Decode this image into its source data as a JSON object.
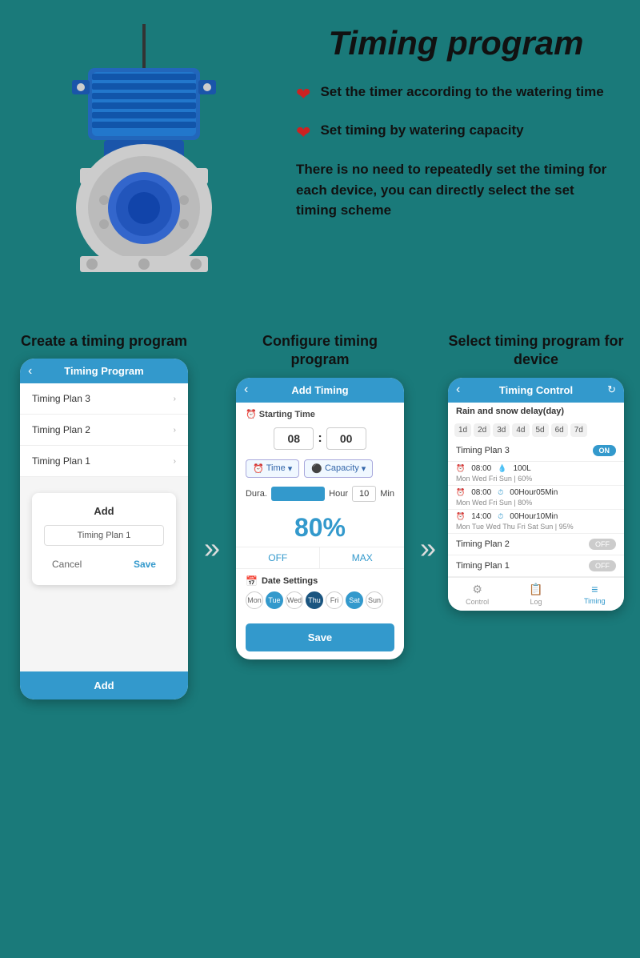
{
  "page": {
    "title": "Timing program",
    "background_color": "#1a7a7a"
  },
  "features": {
    "item1": "Set the timer according to the watering time",
    "item2": "Set timing by watering capacity",
    "description": "There is no need to repeatedly set the timing for each device, you can directly select the set timing scheme"
  },
  "steps": {
    "step1": {
      "title": "Create a timing program",
      "screen": {
        "header": "Timing Program",
        "plans": [
          "Timing Plan 3",
          "Timing Plan 2",
          "Timing Plan 1"
        ],
        "dialog_title": "Add",
        "dialog_input": "Timing Plan 1",
        "cancel_label": "Cancel",
        "save_label": "Save",
        "footer_add": "Add"
      }
    },
    "step2": {
      "title": "Configure timing program",
      "screen": {
        "header": "Add Timing",
        "starting_time_label": "Starting Time",
        "hour": "08",
        "minute": "00",
        "time_label": "Time",
        "capacity_label": "Capacity",
        "dura_label": "Dura.",
        "hour_label": "Hour",
        "min_value": "10",
        "min_label": "Min",
        "percent": "80%",
        "off_label": "OFF",
        "max_label": "MAX",
        "date_settings_label": "Date Settings",
        "days": [
          "Mon",
          "Tue",
          "Wed",
          "Thu",
          "Fri",
          "Sat",
          "Sun"
        ],
        "active_days": [
          "Tue",
          "Thu",
          "Sat"
        ],
        "save_btn": "Save"
      }
    },
    "step3": {
      "title": "Select timing program for device",
      "screen": {
        "header": "Timing Control",
        "rain_delay": "Rain and snow delay(day)",
        "day_buttons": [
          "1d",
          "2d",
          "3d",
          "4d",
          "5d",
          "6d",
          "7d"
        ],
        "plans": [
          {
            "name": "Timing Plan 3",
            "toggle": "ON",
            "entries": [
              {
                "time": "08:00",
                "capacity": "100L",
                "days": "Mon Wed Fri Sun | 60%"
              },
              {
                "time": "08:00",
                "duration": "00Hour05Min",
                "days": "Mon Wed Fri Sun | 80%"
              },
              {
                "time": "14:00",
                "duration": "00Hour10Min",
                "days": "Mon Tue Wed Thu Fri Sat Sun | 95%"
              }
            ]
          },
          {
            "name": "Timing Plan 2",
            "toggle": "OFF"
          },
          {
            "name": "Timing Plan 1",
            "toggle": "OFF"
          }
        ],
        "nav": [
          "Control",
          "Log",
          "Timing"
        ]
      }
    }
  },
  "arrows": {
    "symbol": "»"
  }
}
